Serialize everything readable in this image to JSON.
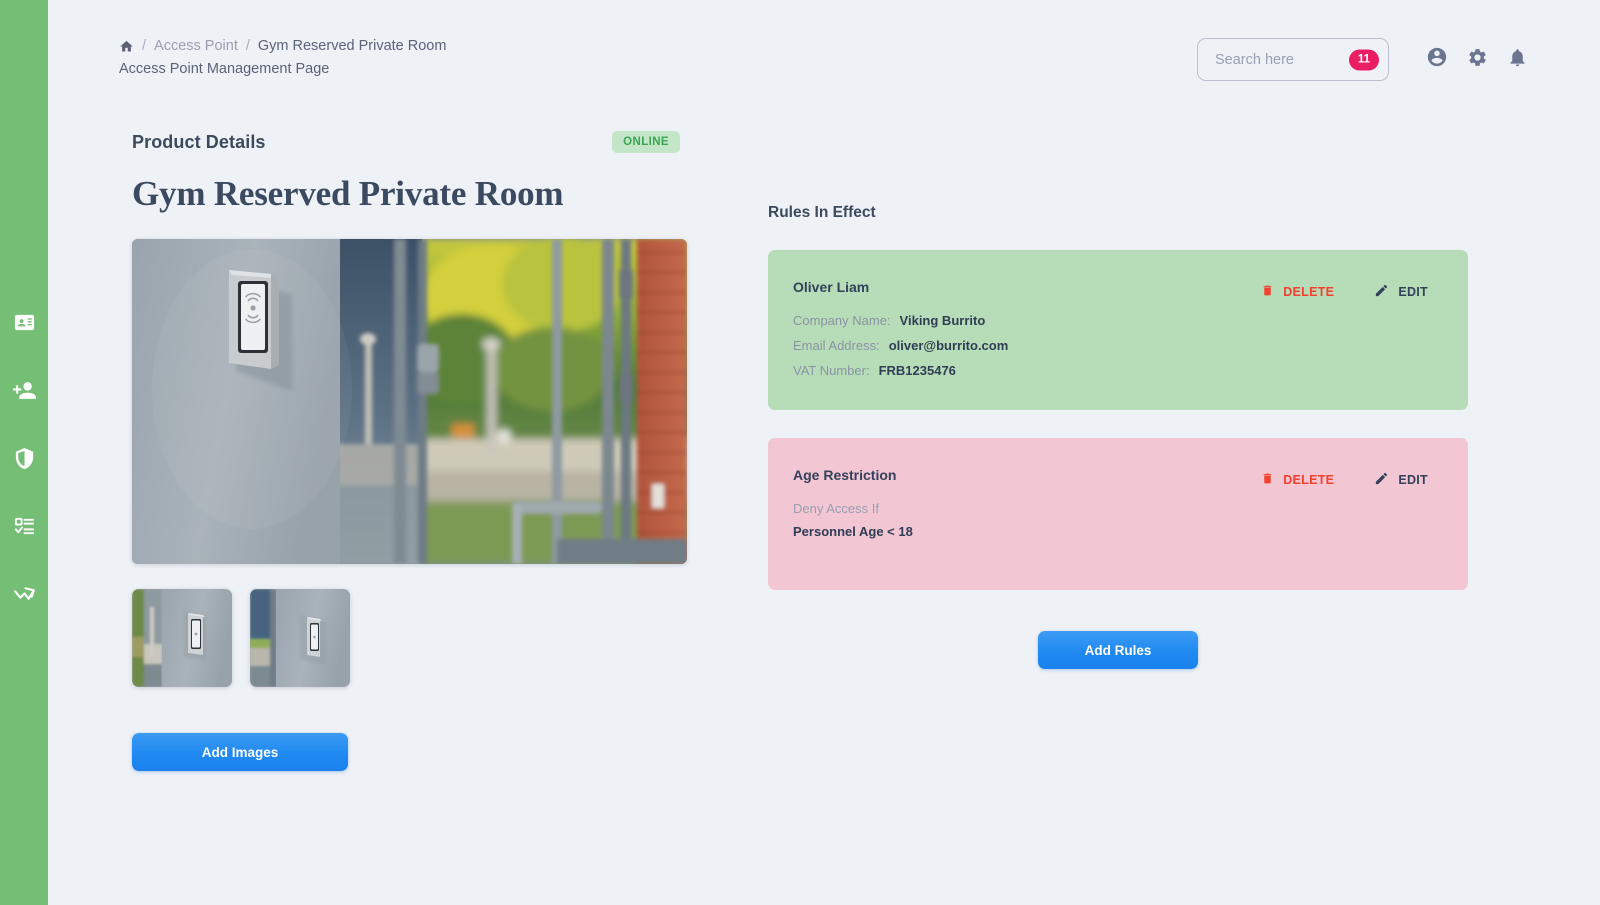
{
  "app": {
    "accent_green": "#75be75",
    "accent_blue": "#2089f0",
    "background": "#eef1f6"
  },
  "sidebar": {
    "items": [
      {
        "icon": "id-badge-icon",
        "name": "sidebar-item-id-badge"
      },
      {
        "icon": "add-people-icon",
        "name": "sidebar-item-add-people"
      },
      {
        "icon": "shield-icon",
        "name": "sidebar-item-shield"
      },
      {
        "icon": "checklist-icon",
        "name": "sidebar-item-checklist"
      },
      {
        "icon": "analytics-icon",
        "name": "sidebar-item-analytics"
      }
    ]
  },
  "header": {
    "breadcrumb": {
      "home_icon": "home-icon",
      "separator": "/",
      "parent": "Access Point",
      "current": "Gym Reserved Private Room"
    },
    "subtitle": "Access Point Management Page",
    "search": {
      "placeholder": "Search here",
      "value": "",
      "badge_count": "11",
      "badge_color": "#e91e63"
    },
    "icons": [
      {
        "icon": "account-circle-icon",
        "name": "account-icon-button"
      },
      {
        "icon": "gear-icon",
        "name": "settings-icon-button"
      },
      {
        "icon": "bell-icon",
        "name": "notifications-icon-button"
      }
    ]
  },
  "product": {
    "section_label": "Product Details",
    "status": "ONLINE",
    "status_color": "#3aa553",
    "name": "Gym Reserved Private Room",
    "hero_image_alt": "access-control-card-reader-on-wall-beside-glass-doors",
    "thumbnails": [
      {
        "alt": "card-reader-thumbnail-wide-view"
      },
      {
        "alt": "card-reader-thumbnail-close-view"
      }
    ],
    "add_images_label": "Add Images"
  },
  "rules": {
    "title": "Rules In Effect",
    "delete_label": "DELETE",
    "edit_label": "EDIT",
    "add_rules_label": "Add Rules",
    "cards": [
      {
        "type": "company",
        "color": "#b6ddb7",
        "heading": "Oliver Liam",
        "fields": [
          {
            "label": "Company Name:",
            "value": "Viking Burrito"
          },
          {
            "label": "Email Address:",
            "value": "oliver@burrito.com"
          },
          {
            "label": "VAT Number:",
            "value": "FRB1235476"
          }
        ]
      },
      {
        "type": "restriction",
        "color": "#f2c6d2",
        "heading": "Age Restriction",
        "condition_label": "Deny Access If",
        "condition_value": "Personnel Age < 18"
      }
    ]
  }
}
